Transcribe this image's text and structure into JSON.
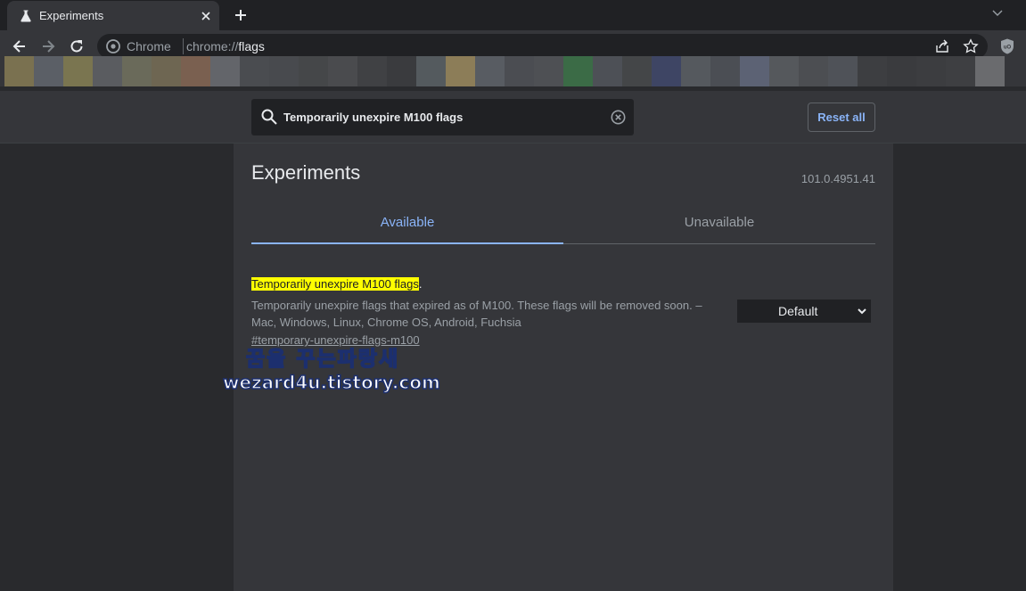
{
  "browser": {
    "tab_title": "Experiments",
    "omnibox_label": "Chrome",
    "url_scheme": "chrome://",
    "url_path": "flags",
    "bookmark_swatches": [
      "#7a7150",
      "#5b5f66",
      "#7a7550",
      "#5a5c60",
      "#6a6a5a",
      "#6e6652",
      "#7a6050",
      "#63656a",
      "#4a4c50",
      "#484a4e",
      "#454749",
      "#4a4b4e",
      "#404144",
      "#3a3b3e",
      "#545a5e",
      "#8c7d58",
      "#585c62",
      "#4b4d52",
      "#4e5054",
      "#3b6b46",
      "#4d5056",
      "#444648",
      "#3e4564",
      "#55595e",
      "#4b4e54",
      "#5c6274",
      "#55585c",
      "#4c4e52",
      "#4f5258",
      "#3d3e41",
      "#3a3b3e",
      "#3c3d40",
      "#3e3f42",
      "#6a6b6e"
    ]
  },
  "search": {
    "value": "Temporarily unexpire M100 flags"
  },
  "header": {
    "reset_label": "Reset all"
  },
  "main": {
    "title": "Experiments",
    "version": "101.0.4951.41",
    "tabs": [
      {
        "label": "Available"
      },
      {
        "label": "Unavailable"
      }
    ]
  },
  "experiment": {
    "title": "Temporarily unexpire M100 flags",
    "title_suffix": ".",
    "description": "Temporarily unexpire flags that expired as of M100. These flags will be removed soon. – Mac, Windows, Linux, Chrome OS, Android, Fuchsia",
    "permalink": "#temporary-unexpire-flags-m100",
    "selected_option": "Default"
  },
  "watermark": {
    "line1": "꿈을 꾸는파랑새",
    "line2": "wezard4u.tistory.com"
  },
  "colors": {
    "accent": "#8ab4f8",
    "highlight": "#ffff00",
    "background": "#35363a"
  }
}
